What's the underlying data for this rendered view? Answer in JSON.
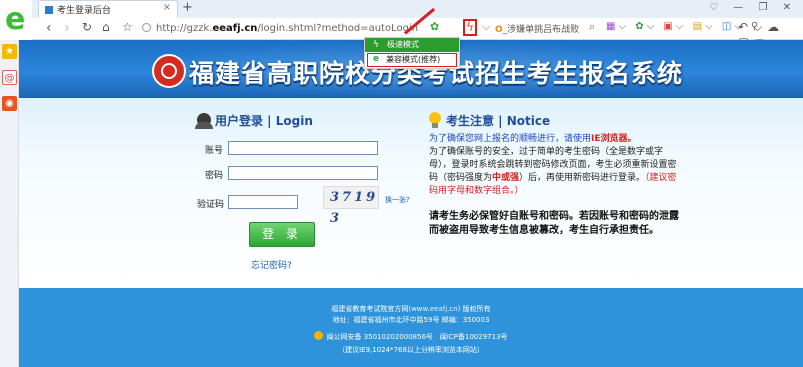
{
  "browser": {
    "tab_title": "考生登录后台",
    "tab_close": "×",
    "new_tab": "+",
    "url_plain": "http://gzzk.",
    "url_host": "eeafj.cn",
    "url_path": "/login.shtml?method=autoLogin",
    "search_text": "_涉嫌单挑吕布战败",
    "win_controls": "♡ — ❐ ✕"
  },
  "mode_menu": {
    "item1": "极速模式",
    "item2": "兼容模式(推荐)"
  },
  "banner": {
    "title": "福建省高职院校分类考试招生考生报名系统"
  },
  "login": {
    "heading": "用户登录 | Login",
    "account_label": "账号",
    "password_label": "密码",
    "captcha_label": "验证码",
    "captcha_text": "3719 3",
    "refresh_text": "换一张?",
    "submit_label": "登 录",
    "forgot_label": "忘记密码?"
  },
  "notice": {
    "heading": "考生注意 | Notice",
    "p1_a": "为了确保您网上报名的顺畅进行，请使用",
    "p1_b": "IE浏览器。",
    "p2_a": "为了确保账号的安全，过于简单的考生密码（全是数字或字母），登录时系统会跳转到密码修改页面，考生必须重新设置密码（密码强度为",
    "p2_b": "中或强",
    "p2_c": "）后，再使用新密码进行登录。",
    "p2_d": "（建议密码用字母和数字组合。）",
    "warn": "请考生务必保管好自账号和密码。若因账号和密码的泄露而被盗用导致考生信息被篡改，考生自行承担责任。"
  },
  "footer": {
    "line1_a": "福建省教育考试院官方网(",
    "line1_link": "www.eeafj.cn",
    "line1_b": ") 版权所有",
    "line2": "地址：福建省福州市北环中路59号 邮编：350003",
    "line3_a": "闽公网安备 35010202000856号",
    "line3_b": "闽ICP备10029713号",
    "line4": "（建议IE9,1024*768以上分辨率浏览本网站）"
  }
}
